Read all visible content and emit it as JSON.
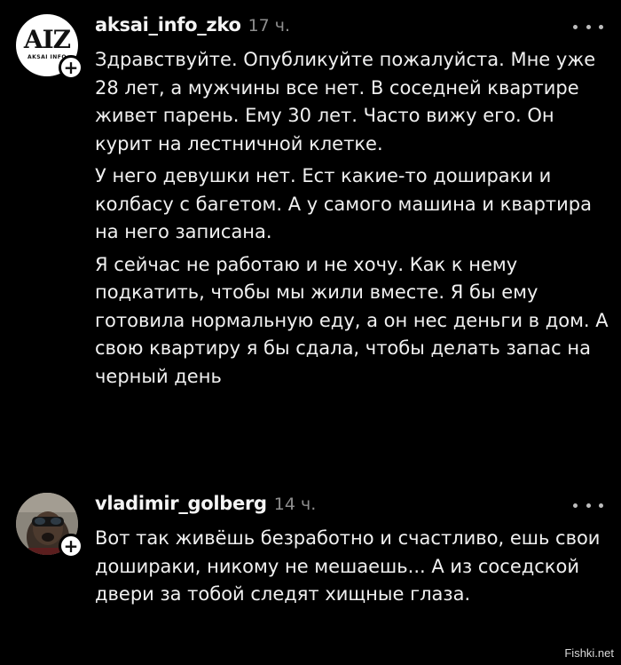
{
  "comments": [
    {
      "username": "aksai_info_zko",
      "time": "17 ч.",
      "avatar": {
        "logo": "AIZ",
        "subtext": "AKSAI INFO"
      },
      "paragraphs": [
        "Здравствуйте. Опубликуйте пожалуйста. Мне уже 28 лет, а мужчины все нет. В соседней квартире живет парень. Ему 30 лет. Часто вижу его. Он курит на лестничной клетке.",
        "У него девушки нет. Ест какие-то дошираки и колбасу с багетом. А у самого машина и квартира на него записана.",
        "Я сейчас не работаю и не хочу. Как к нему подкатить, чтобы мы жили вместе. Я бы ему готовила нормальную еду, а он нес деньги в дом. А свою квартиру я бы сдала, чтобы делать запас на черный день"
      ]
    },
    {
      "username": "vladimir_golberg",
      "time": "14 ч.",
      "paragraphs": [
        "Вот так живёшь безработно и счастливо, ешь свои дошираки, никому не мешаешь... А из соседской двери за тобой следят хищные глаза."
      ]
    }
  ],
  "ui": {
    "plus_symbol": "+",
    "more_icon": "more-dots-icon",
    "plus_icon": "plus-icon"
  },
  "watermark": "Fishki.net",
  "colors": {
    "background": "#000000",
    "text": "#f0f0f0",
    "timestamp": "#8e8e8e"
  }
}
